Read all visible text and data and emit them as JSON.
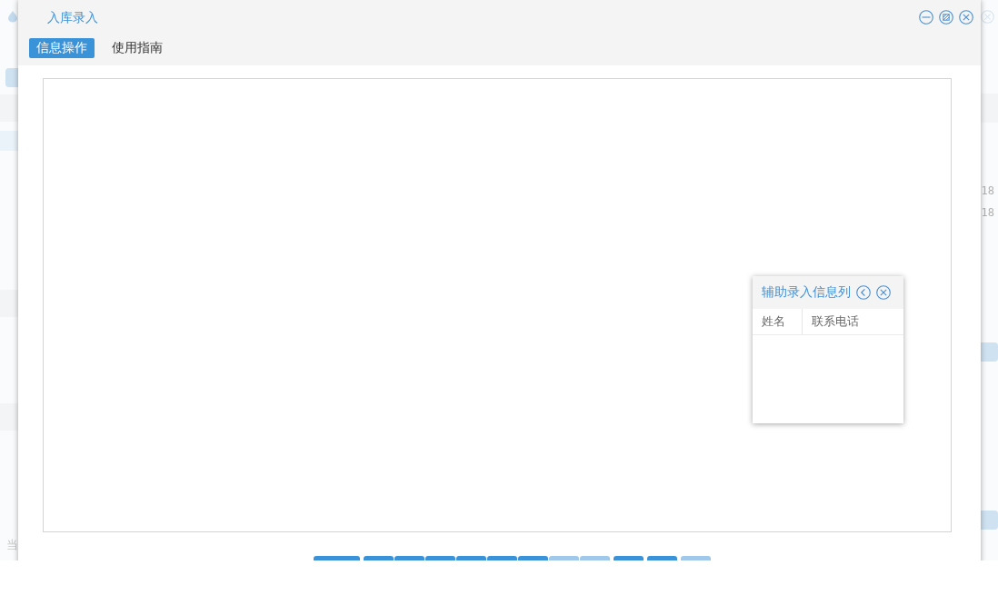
{
  "background_page": {
    "right_values": [
      "18",
      "18"
    ],
    "footer_label": "当"
  },
  "dialog": {
    "title": "入库录入",
    "tabs": [
      {
        "label": "信息操作",
        "selected": true
      },
      {
        "label": "使用指南",
        "selected": false
      }
    ],
    "button_groups": [
      [
        {
          "kind": "wide",
          "disabled": false
        }
      ],
      [
        {
          "kind": "normal",
          "disabled": false
        },
        {
          "kind": "normal",
          "disabled": false
        },
        {
          "kind": "normal",
          "disabled": false
        },
        {
          "kind": "normal",
          "disabled": false
        },
        {
          "kind": "normal",
          "disabled": false
        },
        {
          "kind": "normal",
          "disabled": false
        },
        {
          "kind": "normal",
          "disabled": true
        },
        {
          "kind": "normal",
          "disabled": true
        }
      ],
      [
        {
          "kind": "normal",
          "disabled": false
        }
      ],
      [
        {
          "kind": "normal",
          "disabled": false
        }
      ],
      [
        {
          "kind": "normal",
          "disabled": true
        }
      ]
    ]
  },
  "helper_panel": {
    "title": "辅助录入信息列",
    "columns": [
      "姓名",
      "联系电话"
    ]
  }
}
